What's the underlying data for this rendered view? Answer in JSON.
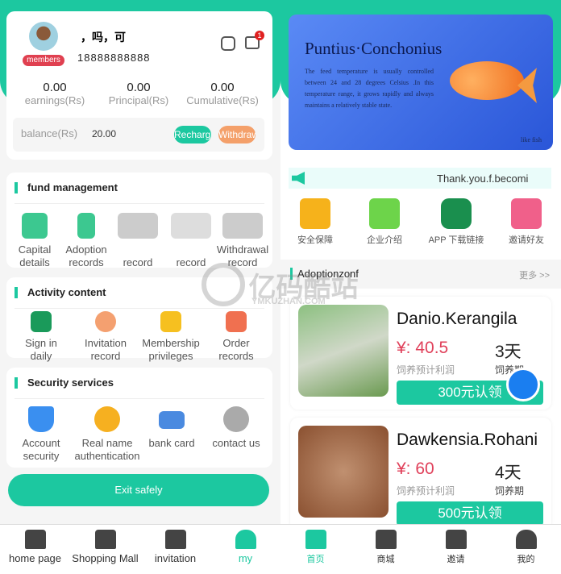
{
  "left": {
    "user": {
      "name": "，吗，可",
      "phone": "18888888888",
      "badge": "members",
      "notification_count": "1"
    },
    "stats": [
      {
        "value": "0.00",
        "label": "earnings(Rs)"
      },
      {
        "value": "0.00",
        "label": "Principal(Rs)"
      },
      {
        "value": "0.00",
        "label": "Cumulative(Rs)"
      }
    ],
    "balance": {
      "label": "balance(Rs)",
      "value": "20.00",
      "recharge": "Recharge",
      "withdraw": "Withdrawal"
    },
    "fund": {
      "title": "fund management",
      "items": [
        {
          "label": "Capital details"
        },
        {
          "label": "Adoption records"
        },
        {
          "label": "record"
        },
        {
          "label": "record"
        },
        {
          "label": "Withdrawal record"
        }
      ]
    },
    "activity": {
      "title": "Activity content",
      "items": [
        {
          "label": "Sign in daily"
        },
        {
          "label": "Invitation record"
        },
        {
          "label": "Membership privileges"
        },
        {
          "label": "Order records"
        }
      ]
    },
    "security": {
      "title": "Security services",
      "items": [
        {
          "label": "Account security"
        },
        {
          "label": "Real name authentication"
        },
        {
          "label": "bank card"
        },
        {
          "label": "contact us"
        }
      ]
    },
    "exit": "Exit safely",
    "nav": [
      {
        "label": "home page"
      },
      {
        "label": "Shopping Mall"
      },
      {
        "label": "invitation"
      },
      {
        "label": "my"
      }
    ]
  },
  "right": {
    "banner": {
      "title": "Puntius·Conchonius",
      "text": "The feed temperature is usually controlled between 24 and 28 degrees Celsius .In this temperature range, it grows rapidly and always maintains a relatively stable state.",
      "tag": "like fish"
    },
    "notice": "Thank.you.f.becomi",
    "shortcuts": [
      {
        "label": "安全保障",
        "color": "#f6b21b"
      },
      {
        "label": "企业介绍",
        "color": "#6dd44a"
      },
      {
        "label": "APP 下载链接",
        "color": "#1a8f4e"
      },
      {
        "label": "邀请好友",
        "color": "#f0608a"
      }
    ],
    "section": {
      "title": "Adoptionzonf",
      "more": "更多 >>"
    },
    "products": [
      {
        "name": "Danio.Kerangila",
        "price": "¥: 40.5",
        "days": "3天",
        "profit_label": "饲养预计利润",
        "period_label": "饲养期",
        "button": "300元认领"
      },
      {
        "name": "Dawkensia.Rohani",
        "price": "¥: 60",
        "days": "4天",
        "profit_label": "饲养预计利润",
        "period_label": "饲养期",
        "button": "500元认领"
      }
    ],
    "nav": [
      {
        "label": "首页"
      },
      {
        "label": "商城"
      },
      {
        "label": "邀请"
      },
      {
        "label": "我的"
      }
    ]
  },
  "watermark": {
    "text": "亿码酷站",
    "sub": "YMKUZHAN.COM"
  },
  "colors": {
    "accent": "#1cc8a0",
    "price": "#e0405a",
    "withdraw": "#f4a06a",
    "badge": "#e04050"
  }
}
